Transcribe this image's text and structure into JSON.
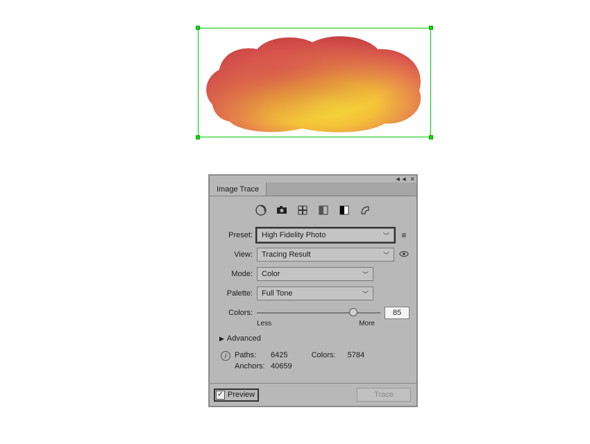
{
  "artwork": {
    "desc": "watercolor-blob-selection"
  },
  "panel": {
    "title": "Image Trace",
    "icons": [
      "auto-color-icon",
      "camera-icon",
      "swatch-icon",
      "grayscale-icon",
      "bw-icon",
      "outline-icon"
    ],
    "preset": {
      "label": "Preset:",
      "value": "High Fidelity Photo"
    },
    "view": {
      "label": "View:",
      "value": "Tracing Result"
    },
    "mode": {
      "label": "Mode:",
      "value": "Color"
    },
    "palette": {
      "label": "Palette:",
      "value": "Full Tone"
    },
    "colors": {
      "label": "Colors:",
      "value": "85",
      "min_label": "Less",
      "max_label": "More"
    },
    "advanced_label": "Advanced",
    "stats": {
      "paths_label": "Paths:",
      "paths": "6425",
      "colors_label": "Colors:",
      "colors": "5784",
      "anchors_label": "Anchors:",
      "anchors": "40659"
    },
    "preview_label": "Preview",
    "preview_checked": true,
    "trace_label": "Trace"
  }
}
